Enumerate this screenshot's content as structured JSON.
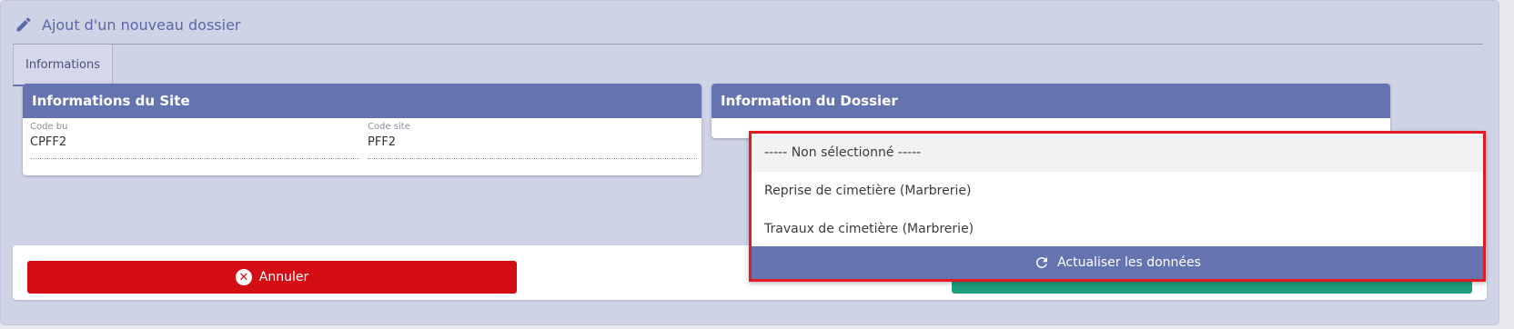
{
  "header": {
    "title": "Ajout d'un nouveau dossier",
    "title_icon": "pencil-icon"
  },
  "tabs": [
    {
      "label": "Informations",
      "active": true
    }
  ],
  "site_card": {
    "title": "Informations du Site",
    "fields": [
      {
        "label": "Code bu",
        "value": "CPFF2"
      },
      {
        "label": "Code site",
        "value": "PFF2"
      }
    ]
  },
  "dossier_card": {
    "title": "Information du Dossier"
  },
  "dropdown": {
    "options": [
      {
        "label": "----- Non sélectionné -----",
        "selected": true
      },
      {
        "label": "Reprise de cimetière (Marbrerie)",
        "selected": false
      },
      {
        "label": "Travaux de cimetière (Marbrerie)",
        "selected": false
      }
    ],
    "refresh_label": "Actualiser les données",
    "refresh_icon": "refresh-icon"
  },
  "actions": {
    "cancel_label": "Annuler",
    "cancel_icon": "close-circle-icon"
  },
  "colors": {
    "accent": "#6574b0",
    "danger": "#d40d14",
    "success": "#1f9e7c",
    "highlight": "#e01b24"
  }
}
